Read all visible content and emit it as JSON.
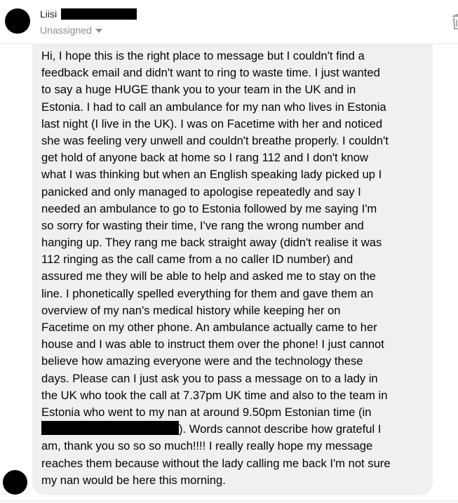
{
  "header": {
    "sender_name": "Liisi",
    "assignee": "Unassigned"
  },
  "message": {
    "lines": [
      "Hi, I hope this is the right place to message but I couldn't find a",
      "feedback email and didn't want to ring to waste time. I just wanted",
      "to say a huge HUGE thank you to your team in the UK and in",
      "Estonia. I had to call an ambulance for my nan who lives in Estonia",
      "last night (I live in the UK). I was on Facetime with her and noticed",
      "she was feeling very unwell and couldn't breathe properly. I couldn't",
      "get hold of anyone back at home so I rang 112 and I don't know",
      "what I was thinking but when an English speaking lady picked up I",
      "panicked and only managed to apologise repeatedly and say I",
      "needed an ambulance to go to Estonia followed by me saying I'm",
      "so sorry for wasting their time, I've rang the wrong number and",
      "hanging up. They rang me back straight away (didn't realise it was",
      "112 ringing as the call came from a no caller ID number) and",
      "assured me they will be able to help and asked me to stay on the",
      "line. I phonetically spelled everything for them and gave them an",
      "overview of my nan's medical history while keeping her on",
      "Facetime on my other phone. An ambulance actually came to her",
      "house and I was able to instruct them over the phone! I just cannot",
      "believe how amazing everyone were and the technology these",
      "days. Please can I just ask you to pass a message on to a lady in",
      "the UK who took the call at 7.37pm UK time and also to the team in",
      "Estonia who went to my nan at around 9.50pm Estonian time (in"
    ],
    "redacted_line_tail": "). Words cannot describe how grateful I",
    "tail_lines": [
      "am, thank you so so so much!!!! I really really hope my message",
      "reaches them because without the lady calling me back I'm not sure",
      "my nan would be here this morning."
    ]
  },
  "icons": {
    "trash": "trash-icon",
    "dropdown": "caret-down-icon"
  },
  "colors": {
    "bubble_background": "#f0f0f0",
    "muted_text": "#8a8d91",
    "redaction": "#000000"
  }
}
